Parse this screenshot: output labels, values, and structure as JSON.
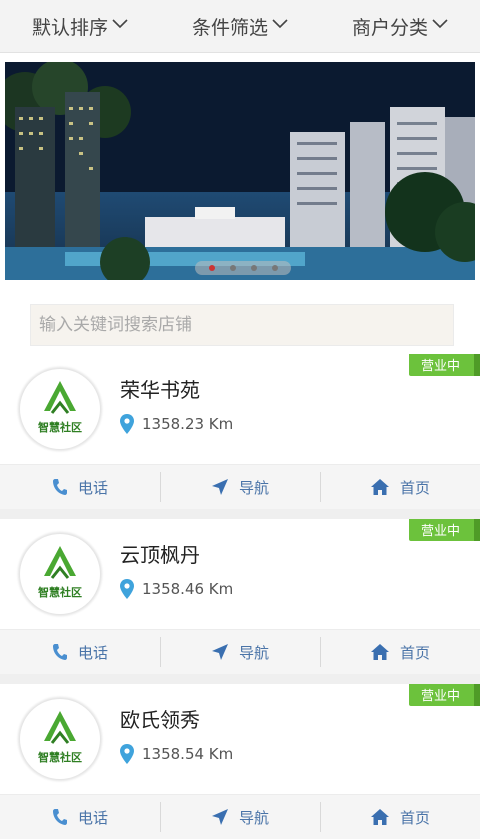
{
  "filters": [
    {
      "label": "默认排序"
    },
    {
      "label": "条件筛选"
    },
    {
      "label": "商户分类"
    }
  ],
  "banner": {
    "dot_count": 4,
    "active_index": 0
  },
  "search": {
    "placeholder": "输入关键词搜索店铺"
  },
  "stores": [
    {
      "name": "荣华书苑",
      "distance": "1358.23 Km",
      "status": "营业中",
      "logo_text": "智慧社区"
    },
    {
      "name": "云顶枫丹",
      "distance": "1358.46 Km",
      "status": "营业中",
      "logo_text": "智慧社区"
    },
    {
      "name": "欧氏领秀",
      "distance": "1358.54 Km",
      "status": "营业中",
      "logo_text": "智慧社区"
    }
  ],
  "actions": {
    "phone": "电话",
    "navigate": "导航",
    "home": "首页"
  },
  "colors": {
    "accent": "#6cc23c",
    "link": "#4a74a8",
    "pin": "#3fa3dc"
  }
}
